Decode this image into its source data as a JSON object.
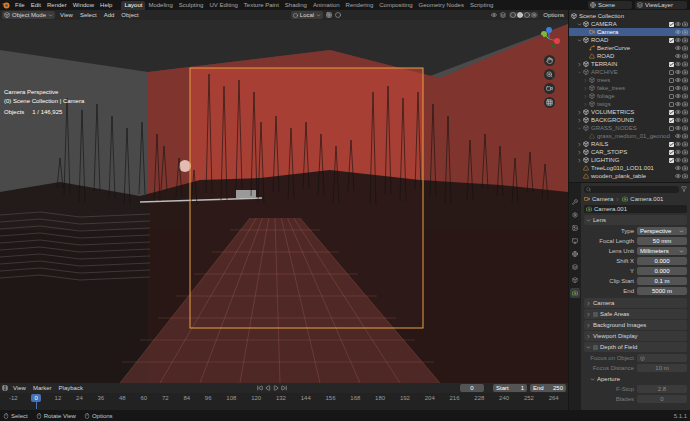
{
  "topbar": {
    "menus": [
      "File",
      "Edit",
      "Render",
      "Window",
      "Help"
    ],
    "workspaces": [
      {
        "label": "Layout",
        "selected": true
      },
      {
        "label": "Modeling",
        "selected": false
      },
      {
        "label": "Sculpting",
        "selected": false
      },
      {
        "label": "UV Editing",
        "selected": false
      },
      {
        "label": "Texture Paint",
        "selected": false
      },
      {
        "label": "Shading",
        "selected": false
      },
      {
        "label": "Animation",
        "selected": false
      },
      {
        "label": "Rendering",
        "selected": false
      },
      {
        "label": "Compositing",
        "selected": false
      },
      {
        "label": "Geometry Nodes",
        "selected": false
      },
      {
        "label": "Scripting",
        "selected": false
      }
    ],
    "scene": "Scene",
    "view_layer": "ViewLayer"
  },
  "viewport": {
    "mode": "Object Mode",
    "menus": [
      "View",
      "Select",
      "Add",
      "Object"
    ],
    "orientation": "Local",
    "options": "Options",
    "overlay": {
      "view": "Camera Perspective",
      "context": "(0) Scene Collection | Camera",
      "objects_label": "Objects",
      "objects_count": "1 / 146,925"
    }
  },
  "outliner": {
    "root": "Scene Collection",
    "items": [
      {
        "name": "CAMERA",
        "kind": "collection",
        "expanded": true,
        "excluded": false,
        "selected": false,
        "children": [
          {
            "name": "Camera",
            "kind": "camera",
            "excluded": false,
            "selected": true,
            "children": []
          }
        ]
      },
      {
        "name": "ROAD",
        "kind": "collection",
        "expanded": true,
        "excluded": false,
        "selected": false,
        "children": [
          {
            "name": "BezierCurve",
            "kind": "curve",
            "excluded": false,
            "selected": false,
            "children": []
          },
          {
            "name": "ROAD",
            "kind": "mesh",
            "excluded": false,
            "selected": false,
            "children": []
          }
        ]
      },
      {
        "name": "TERRAIN",
        "kind": "collection",
        "expanded": false,
        "excluded": false,
        "selected": false,
        "children": []
      },
      {
        "name": "ARCHIVE",
        "kind": "collection",
        "expanded": true,
        "excluded": true,
        "selected": false,
        "children": [
          {
            "name": "trees",
            "kind": "collection",
            "expanded": false,
            "excluded": true,
            "selected": false,
            "children": []
          },
          {
            "name": "fake_trees",
            "kind": "collection",
            "expanded": false,
            "excluded": true,
            "selected": false,
            "children": []
          },
          {
            "name": "foliage",
            "kind": "collection",
            "expanded": false,
            "excluded": true,
            "selected": false,
            "children": []
          },
          {
            "name": "twigs",
            "kind": "collection",
            "expanded": false,
            "excluded": true,
            "selected": false,
            "children": []
          }
        ]
      },
      {
        "name": "VOLUMETRICS",
        "kind": "collection",
        "expanded": false,
        "excluded": false,
        "selected": false,
        "children": []
      },
      {
        "name": "BACKGROUND",
        "kind": "collection",
        "expanded": false,
        "excluded": false,
        "selected": false,
        "children": []
      },
      {
        "name": "GRASS_NODES",
        "kind": "collection",
        "expanded": true,
        "excluded": true,
        "selected": false,
        "children": [
          {
            "name": "grass_medium_01_geonod",
            "kind": "mesh",
            "excluded": true,
            "selected": false,
            "children": []
          }
        ]
      },
      {
        "name": "RAILS",
        "kind": "collection",
        "expanded": false,
        "excluded": false,
        "selected": false,
        "children": []
      },
      {
        "name": "CAR_STOPS",
        "kind": "collection",
        "expanded": false,
        "excluded": false,
        "selected": false,
        "children": []
      },
      {
        "name": "LIGHTING",
        "kind": "collection",
        "expanded": false,
        "excluded": false,
        "selected": false,
        "children": []
      },
      {
        "name": "TreeLog010_LOD1.001",
        "kind": "mesh",
        "excluded": false,
        "selected": false,
        "children": []
      },
      {
        "name": "wooden_plank_table",
        "kind": "mesh",
        "excluded": false,
        "selected": false,
        "children": []
      }
    ]
  },
  "properties": {
    "breadcrumb": [
      "Camera",
      "Camera.001"
    ],
    "datablock": "Camera.001",
    "panels": [
      {
        "title": "Lens",
        "expanded": true,
        "rows": [
          {
            "label": "Type",
            "value": "Perspective",
            "kind": "dropdown",
            "disabled": false
          },
          {
            "label": "Focal Length",
            "value": "50 mm",
            "kind": "number",
            "disabled": false
          },
          {
            "label": "Lens Unit",
            "value": "Millimeters",
            "kind": "dropdown",
            "disabled": false
          },
          {
            "label": "Shift X",
            "value": "0.000",
            "kind": "number",
            "disabled": false
          },
          {
            "label": "Y",
            "value": "0.000",
            "kind": "number",
            "disabled": false
          },
          {
            "label": "Clip Start",
            "value": "0.1 m",
            "kind": "number",
            "disabled": false
          },
          {
            "label": "End",
            "value": "5000 m",
            "kind": "number",
            "disabled": false
          }
        ]
      },
      {
        "title": "Camera",
        "expanded": false,
        "rows": []
      },
      {
        "title": "Safe Areas",
        "expanded": false,
        "checkbox": false,
        "rows": []
      },
      {
        "title": "Background Images",
        "expanded": false,
        "rows": []
      },
      {
        "title": "Viewport Display",
        "expanded": false,
        "rows": []
      },
      {
        "title": "Depth of Field",
        "expanded": true,
        "checkbox": false,
        "rows": [
          {
            "label": "Focus on Object",
            "kind": "picker",
            "disabled": true
          },
          {
            "label": "Focus Distance",
            "value": "10 m",
            "kind": "number",
            "disabled": true
          },
          {
            "label": "Aperture",
            "kind": "subpanel",
            "expanded": true,
            "disabled": false
          },
          {
            "label": "F-Stop",
            "value": "2.8",
            "kind": "number",
            "disabled": true
          },
          {
            "label": "Blades",
            "value": "0",
            "kind": "number",
            "disabled": true
          }
        ]
      }
    ]
  },
  "timeline": {
    "menus": [
      "View",
      "Marker",
      "Playback"
    ],
    "frame": "0",
    "start_label": "Start",
    "start": "1",
    "end_label": "End",
    "end": "250",
    "ticks": [
      {
        "label": "-12",
        "selected": false
      },
      {
        "label": "0",
        "selected": true
      },
      {
        "label": "12",
        "selected": false
      },
      {
        "label": "24",
        "selected": false
      },
      {
        "label": "36",
        "selected": false
      },
      {
        "label": "48",
        "selected": false
      },
      {
        "label": "60",
        "selected": false
      },
      {
        "label": "72",
        "selected": false
      },
      {
        "label": "84",
        "selected": false
      },
      {
        "label": "96",
        "selected": false
      },
      {
        "label": "108",
        "selected": false
      },
      {
        "label": "120",
        "selected": false
      },
      {
        "label": "132",
        "selected": false
      },
      {
        "label": "144",
        "selected": false
      },
      {
        "label": "156",
        "selected": false
      },
      {
        "label": "168",
        "selected": false
      },
      {
        "label": "180",
        "selected": false
      },
      {
        "label": "192",
        "selected": false
      },
      {
        "label": "204",
        "selected": false
      },
      {
        "label": "216",
        "selected": false
      },
      {
        "label": "228",
        "selected": false
      },
      {
        "label": "240",
        "selected": false
      },
      {
        "label": "252",
        "selected": false
      },
      {
        "label": "264",
        "selected": false
      }
    ]
  },
  "status_bar": {
    "hints": [
      "Select",
      "Rotate View",
      "Options"
    ],
    "version": "5.1.1"
  }
}
